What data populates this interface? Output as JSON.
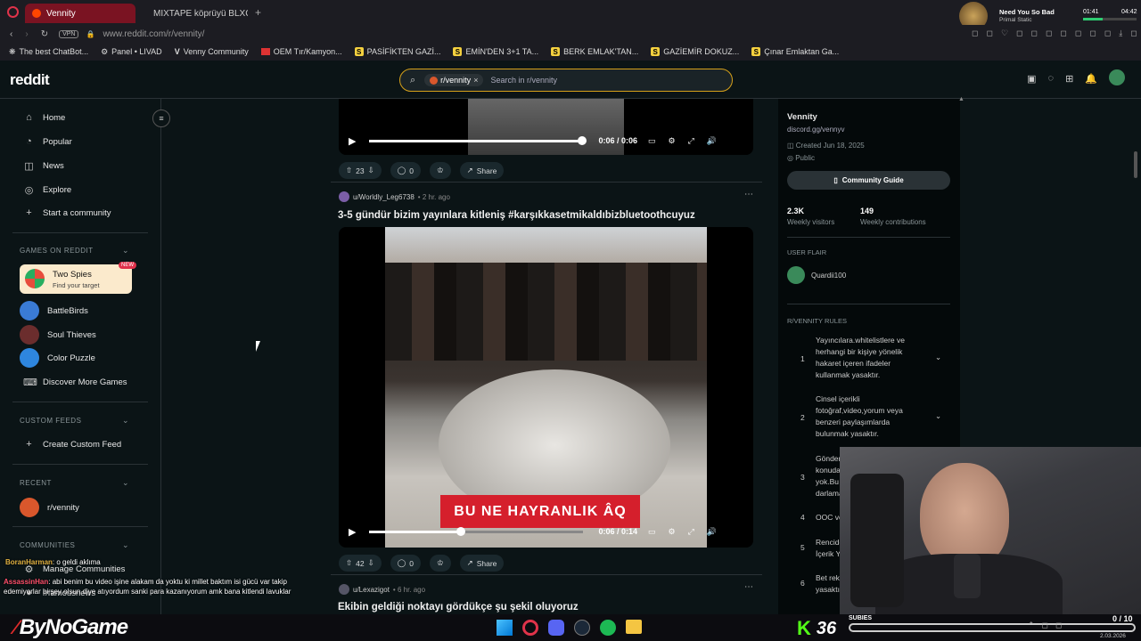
{
  "browser": {
    "tabs": [
      {
        "label": "Vennity",
        "active": true
      },
      {
        "label": "MIXTAPE köprüyü BLXCKC"
      }
    ],
    "vpn_label": "VPN",
    "url": "www.reddit.com/r/vennity/",
    "bookmarks": [
      {
        "label": "The best ChatBot..."
      },
      {
        "label": "Panel • LIVAD"
      },
      {
        "label": "Venny Community"
      },
      {
        "label": "OEM Tır/Kamyon..."
      },
      {
        "label": "PASİFİKTEN GAZİ..."
      },
      {
        "label": "EMİN'DEN 3+1 TA..."
      },
      {
        "label": "BERK EMLAK'TAN..."
      },
      {
        "label": "GAZİEMİR DOKUZ..."
      },
      {
        "label": "Çınar Emlaktan Ga..."
      }
    ],
    "music": {
      "title": "Need You So Bad",
      "artist": "Primal Static",
      "time_elapsed": "01:41",
      "time_total": "04:42"
    }
  },
  "reddit": {
    "logo": "reddit",
    "search": {
      "chip": "r/vennity",
      "placeholder": "Search in r/vennity"
    }
  },
  "sidebar": {
    "nav": [
      {
        "label": "Home",
        "icon": "home-icon"
      },
      {
        "label": "Popular",
        "icon": "popular-icon"
      },
      {
        "label": "News",
        "icon": "news-icon"
      },
      {
        "label": "Explore",
        "icon": "explore-icon"
      },
      {
        "label": "Start a community",
        "icon": "plus-icon"
      }
    ],
    "games_header": "GAMES ON REDDIT",
    "featured_game": {
      "title": "Two Spies",
      "subtitle": "Find your target",
      "badge": "NEW"
    },
    "games": [
      {
        "label": "BattleBirds",
        "color": "#3a7bd5"
      },
      {
        "label": "Soul Thieves",
        "color": "#6b2d2d"
      },
      {
        "label": "Color Puzzle",
        "color": "#2e86de"
      },
      {
        "label": "Discover More Games",
        "color": ""
      }
    ],
    "custom_feeds_header": "CUSTOM FEEDS",
    "create_feed": "Create Custom Feed",
    "recent_header": "RECENT",
    "recent": [
      {
        "label": "r/vennity"
      }
    ],
    "communities_header": "COMMUNITIES",
    "manage": "Manage Communities",
    "next_community": "r/famousnews"
  },
  "feed": {
    "post0": {
      "time": "0:06 / 0:06",
      "progress": 1.0,
      "votes": "23",
      "comments": "0",
      "share": "Share"
    },
    "post1": {
      "author": "u/Worldly_Leg6738",
      "age": "• 2 hr. ago",
      "title": "3-5 gündür bizim yayınlara kitleniş #karşıkkasetmikaldıbizbluetoothcuyuz",
      "caption": "BU NE HAYRANLIK ÂQ",
      "time": "0:06 / 0:14",
      "progress": 0.43,
      "votes": "42",
      "comments": "0",
      "share": "Share"
    },
    "post2": {
      "author": "u/Lexazigot",
      "age": "• 6 hr. ago",
      "title": "Ekibin geldiği noktayı gördükçe şu şekil oluyoruz"
    }
  },
  "community": {
    "name": "Vennity",
    "link": "discord.gg/vennyv",
    "created": "Created Jun 18, 2025",
    "visibility": "Public",
    "guide_button": "Community Guide",
    "stats": [
      {
        "value": "2.3K",
        "label": "Weekly visitors"
      },
      {
        "value": "149",
        "label": "Weekly contributions"
      }
    ],
    "flair_header": "USER FLAIR",
    "flair_user": "Quardii100",
    "rules_header": "R/VENNITY RULES",
    "rules": [
      {
        "num": "1",
        "text": [
          "Yayıncılara.whitelistlere ve",
          "herhangi bir kişiye yönelik",
          "hakaret içeren ifadeler",
          "kullanmak yasaktır."
        ]
      },
      {
        "num": "2",
        "text": [
          "Cinsel içerikli",
          "fotoğraf,video,yorum veya",
          "benzeri paylaşımlarda",
          "bulunmak yasaktır."
        ]
      },
      {
        "num": "3",
        "text": [
          "Gönder",
          "konuda",
          "yok.Bu",
          "darlama"
        ]
      },
      {
        "num": "4",
        "text": [
          "OOC ve"
        ]
      },
      {
        "num": "5",
        "text": [
          "Rencide",
          "İçerik Y"
        ]
      },
      {
        "num": "6",
        "text": [
          "Bet rekl",
          "yasaktır"
        ]
      }
    ]
  },
  "stream": {
    "chat": [
      {
        "user": "BoranHarman",
        "msg": ": o geldi aklıma",
        "color": "#e0b040"
      },
      {
        "user": "AssassinHan",
        "msg": ": abi benim bu video işine alakam da yoktu ki millet baktım isi gücü var takip edemiyorlar bi şey olsun diye atıyordum sanki para kazanıyorum amk bana kitlendi lavuklar",
        "color": "#ff4f6a"
      }
    ],
    "brand": "ByNoGame",
    "kick_count": "36",
    "subies_label": "SUBIES",
    "subies_count": "0 / 10",
    "date": "2.03.2026"
  }
}
